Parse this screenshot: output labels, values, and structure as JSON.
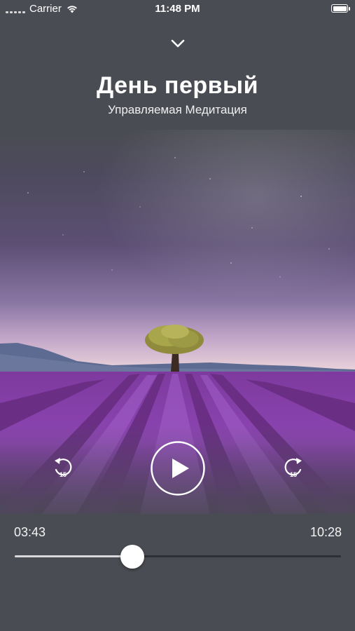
{
  "status_bar": {
    "carrier": "Carrier",
    "time": "11:48 PM"
  },
  "header": {
    "collapse_icon": "chevron-down-icon",
    "title": "День первый",
    "subtitle": "Управляемая Медитация"
  },
  "artwork": {
    "icon": "lavender-field-image"
  },
  "controls": {
    "rewind_icon": "rewind-15-icon",
    "rewind_seconds": "15",
    "play_icon": "play-icon",
    "forward_icon": "forward-15-icon",
    "forward_seconds": "15"
  },
  "playback": {
    "current_time": "03:43",
    "total_time": "10:28",
    "progress": 0.36
  },
  "colors": {
    "background": "#4a4c53",
    "accent": "#ffffff",
    "lavender": "#8a3fb0"
  }
}
